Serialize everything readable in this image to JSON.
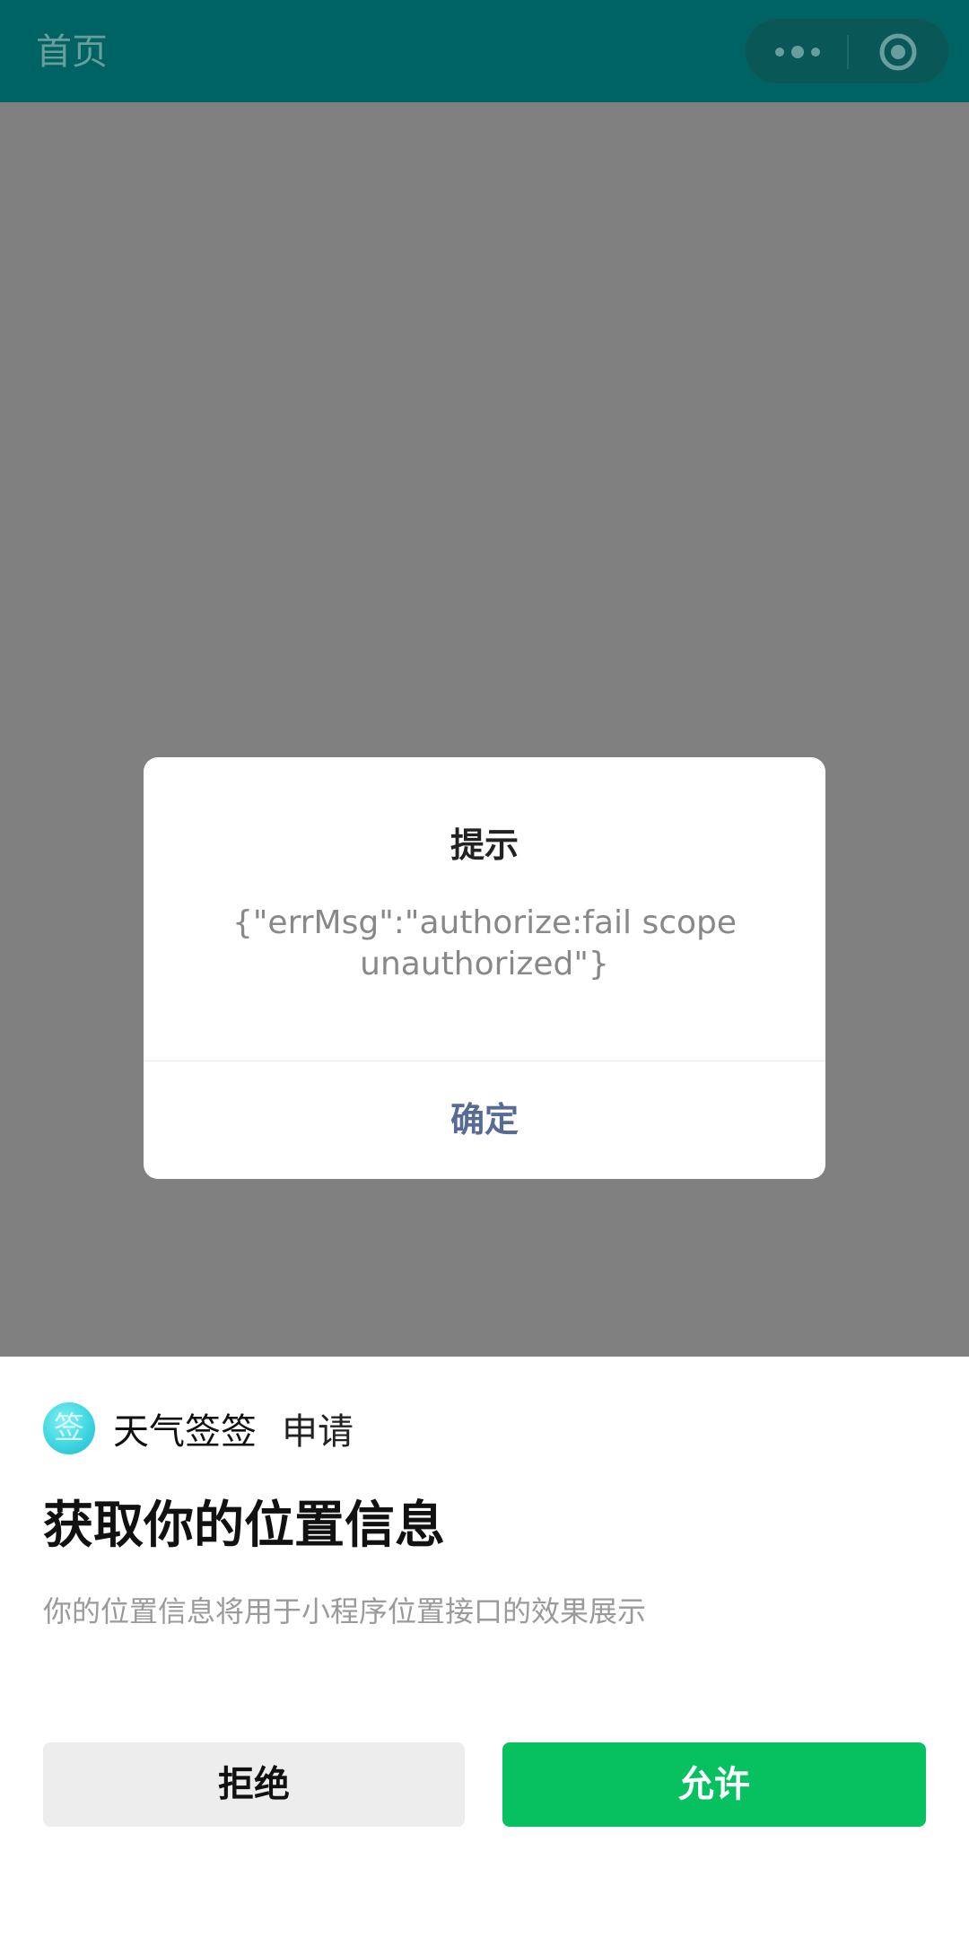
{
  "navbar": {
    "title": "首页",
    "more_icon": "more-dots-icon",
    "close_icon": "target-circle-icon",
    "background": "#006363"
  },
  "alert": {
    "title": "提示",
    "message": "{\"errMsg\":\"authorize:fail scope unauthorized\"}",
    "confirm_label": "确定",
    "confirm_color": "#576b95"
  },
  "auth_sheet": {
    "app_logo_icon": "app-logo-icon",
    "app_logo_glyph": "签",
    "app_name": "天气签签",
    "request_label": "申请",
    "title": "获取你的位置信息",
    "description": "你的位置信息将用于小程序位置接口的效果展示",
    "reject_label": "拒绝",
    "allow_label": "允许",
    "allow_color": "#07c160"
  }
}
